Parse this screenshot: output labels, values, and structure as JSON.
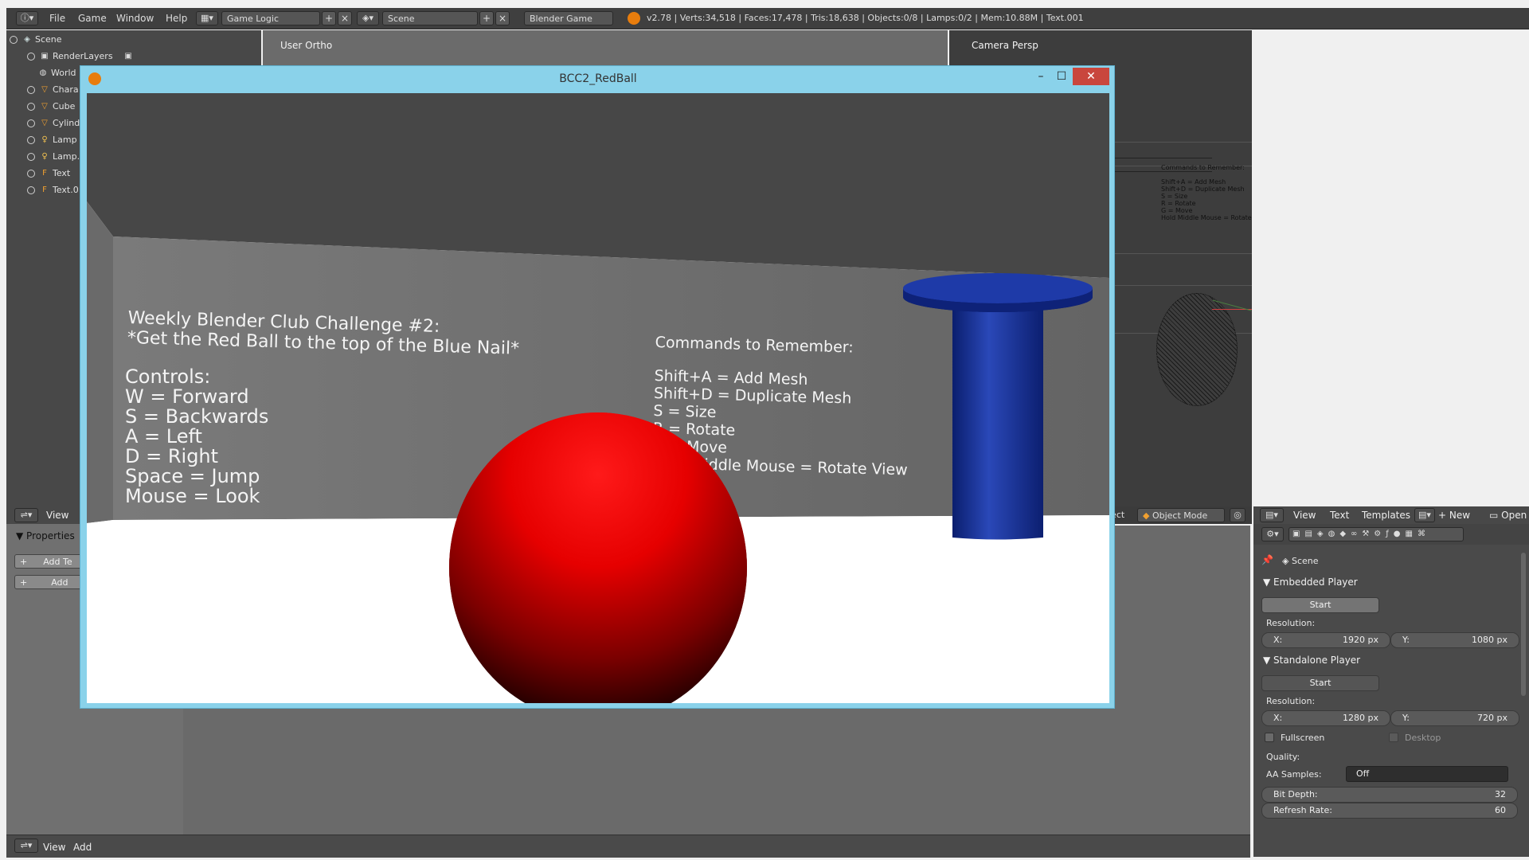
{
  "topbar": {
    "menu": [
      "File",
      "Game",
      "Window",
      "Help"
    ],
    "layout_value": "Game Logic",
    "scene_value": "Scene",
    "engine_value": "Blender Game",
    "stats": "v2.78 | Verts:34,518 | Faces:17,478 | Tris:18,638 | Objects:0/8 | Lamps:0/2 | Mem:10.88M | Text.001"
  },
  "outliner": {
    "items": [
      {
        "label": "Scene",
        "icon": "scene-icon"
      },
      {
        "label": "RenderLayers",
        "icon": "renderlayers-icon"
      },
      {
        "label": "World",
        "icon": "world-icon"
      },
      {
        "label": "Chara",
        "icon": "mesh-icon"
      },
      {
        "label": "Cube",
        "icon": "mesh-icon"
      },
      {
        "label": "Cylind",
        "icon": "mesh-icon"
      },
      {
        "label": "Lamp",
        "icon": "lamp-icon"
      },
      {
        "label": "Lamp.",
        "icon": "lamp-icon"
      },
      {
        "label": "Text",
        "icon": "text-icon"
      },
      {
        "label": "Text.0",
        "icon": "text-icon"
      }
    ]
  },
  "viewports": {
    "left_label": "User Ortho",
    "right_label": "Camera Persp",
    "mini_commands_title": "Commands to Remember:",
    "mini_commands": [
      "Shift+A = Add Mesh",
      "Shift+D = Duplicate Mesh",
      "S = Size",
      "R = Rotate",
      "G = Move",
      "Hold Middle Mouse = Rotate"
    ],
    "mode_partial": "ject",
    "mode_value": "Object Mode"
  },
  "left_panel": {
    "view_label": "View",
    "properties_label": "Properties",
    "add_text_label": "Add Te",
    "add_label": "Add"
  },
  "bottom_bar": {
    "view_label": "View",
    "add_label": "Add"
  },
  "text_editor_header": {
    "view": "View",
    "text": "Text",
    "templates": "Templates",
    "new": "New",
    "open": "Open"
  },
  "properties": {
    "scene_label": "Scene",
    "embedded": {
      "title": "Embedded Player",
      "start": "Start",
      "resolution_label": "Resolution:",
      "x_label": "X:",
      "x_value": "1920 px",
      "y_label": "Y:",
      "y_value": "1080 px"
    },
    "standalone": {
      "title": "Standalone Player",
      "start": "Start",
      "resolution_label": "Resolution:",
      "x_label": "X:",
      "x_value": "1280 px",
      "y_label": "Y:",
      "y_value": "720 px",
      "fullscreen": "Fullscreen",
      "desktop": "Desktop",
      "quality_label": "Quality:",
      "aa_label": "AA Samples:",
      "aa_value": "Off",
      "bit_depth_label": "Bit Depth:",
      "bit_depth_value": "32",
      "refresh_label": "Refresh Rate:",
      "refresh_value": "60"
    }
  },
  "game_window": {
    "title": "BCC2_RedBall",
    "minimize": "–",
    "maximize": "☐",
    "close": "✕",
    "wall_left": {
      "line1": "Weekly Blender Club Challenge #2:",
      "line2": "*Get the Red Ball to the top of the Blue Nail*",
      "controls_title": "Controls:",
      "controls": [
        "W = Forward",
        "S = Backwards",
        "A = Left",
        "D = Right",
        "Space = Jump",
        "Mouse = Look"
      ]
    },
    "wall_right": {
      "title": "Commands to Remember:",
      "lines": [
        "Shift+A = Add Mesh",
        "Shift+D = Duplicate Mesh",
        "S = Size",
        "R = Rotate",
        "G = Move",
        "Hold Middle Mouse = Rotate View"
      ]
    }
  },
  "colors": {
    "ball": "#e01010",
    "nail": "#1f3aa0",
    "wall": "#6f6f6f",
    "ceiling": "#474747",
    "floor": "#ffffff",
    "window_frame": "#8ad2ea"
  }
}
